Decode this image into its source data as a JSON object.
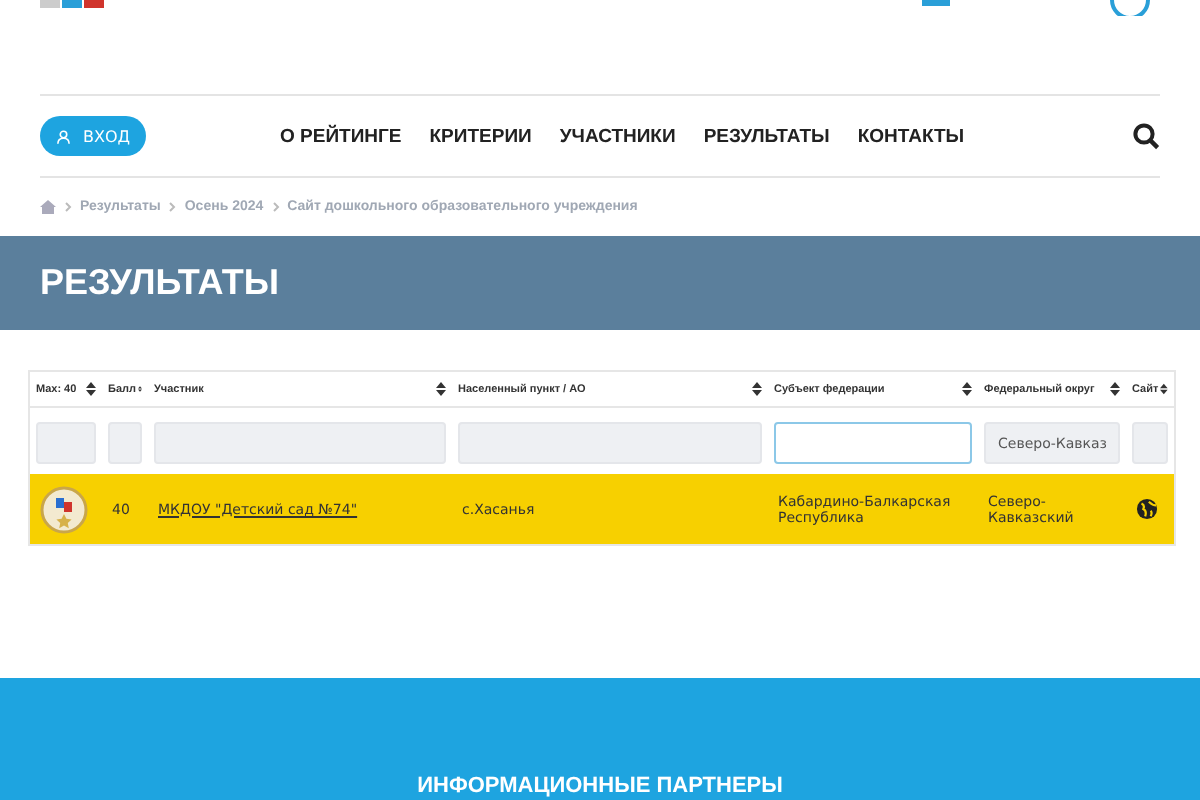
{
  "header": {
    "login_button": "ВХОД",
    "nav": [
      {
        "label": "О РЕЙТИНГЕ"
      },
      {
        "label": "КРИТЕРИИ"
      },
      {
        "label": "УЧАСТНИКИ"
      },
      {
        "label": "РЕЗУЛЬТАТЫ"
      },
      {
        "label": "КОНТАКТЫ"
      }
    ]
  },
  "breadcrumb": [
    "Результаты",
    "Осень 2024",
    "Сайт дошкольного образовательного учреждения"
  ],
  "page_title": "РЕЗУЛЬТАТЫ",
  "table": {
    "columns": [
      {
        "label": "Max: 40"
      },
      {
        "label": "Балл"
      },
      {
        "label": "Участник"
      },
      {
        "label": "Населенный пункт / АО"
      },
      {
        "label": "Субъект федерации"
      },
      {
        "label": "Федеральный округ"
      },
      {
        "label": "Сайт"
      }
    ],
    "filters": [
      {
        "focused": false
      },
      {
        "focused": false
      },
      {
        "focused": false
      },
      {
        "focused": false
      },
      {
        "focused": true
      },
      {
        "value": "Северо-Кавказ",
        "focused": false
      },
      {
        "focused": false
      }
    ],
    "rows": [
      {
        "highlighted": true,
        "score": "40",
        "participant": "МКДОУ \"Детский сад №74\"",
        "locality": "с.Хасанья",
        "region": "Кабардино-Балкарская Республика",
        "district": "Северо-Кавказский"
      }
    ]
  },
  "partners_title": "ИНФОРМАЦИОННЫЕ ПАРТНЕРЫ"
}
